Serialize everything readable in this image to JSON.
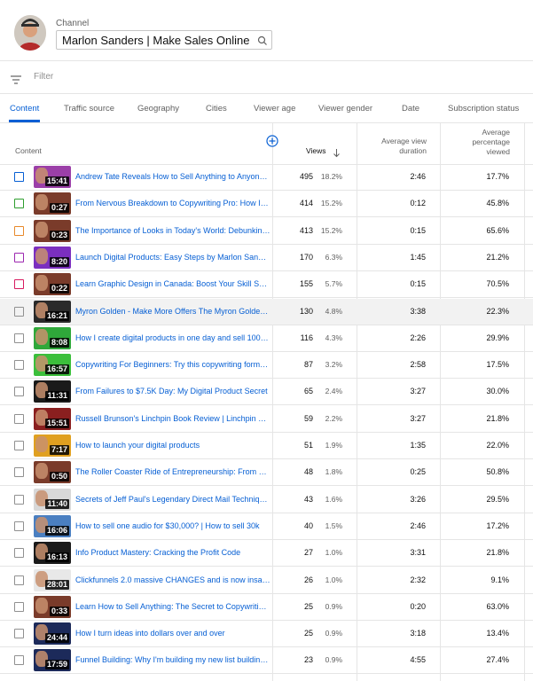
{
  "channel": {
    "label": "Channel",
    "name": "Marlon Sanders | Make Sales Online"
  },
  "filter": {
    "label": "Filter"
  },
  "tabs": [
    {
      "label": "Content",
      "active": true
    },
    {
      "label": "Traffic source"
    },
    {
      "label": "Geography"
    },
    {
      "label": "Cities"
    },
    {
      "label": "Viewer age"
    },
    {
      "label": "Viewer gender"
    },
    {
      "label": "Date"
    },
    {
      "label": "Subscription status"
    }
  ],
  "columns": {
    "content": "Content",
    "views": "Views",
    "avd": [
      "Average view",
      "duration"
    ],
    "avp": [
      "Average",
      "percentage",
      "viewed"
    ]
  },
  "colors": {
    "accent": "#065fd4"
  },
  "rows": [
    {
      "title": "Andrew Tate Reveals How to Sell Anything to Anyone | ...",
      "duration": "15:41",
      "views": "495",
      "pct": "18.2%",
      "avd": "2:46",
      "avp": "17.7%",
      "check": "#065fd4",
      "thumb": "#9b3fa8"
    },
    {
      "title": "From Nervous Breakdown to Copywriting Pro: How I O...",
      "duration": "0:27",
      "views": "414",
      "pct": "15.2%",
      "avd": "0:12",
      "avp": "45.8%",
      "check": "#2e9e2e",
      "thumb": "#7a3b2a"
    },
    {
      "title": "The Importance of Looks in Today's World: Debunking ...",
      "duration": "0:23",
      "views": "413",
      "pct": "15.2%",
      "avd": "0:15",
      "avp": "65.6%",
      "check": "#e8892b",
      "thumb": "#7a3b2a"
    },
    {
      "title": "Launch Digital Products: Easy Steps by Marlon Sanders",
      "duration": "8:20",
      "views": "170",
      "pct": "6.3%",
      "avd": "1:45",
      "avp": "21.2%",
      "check": "#9c27b0",
      "thumb": "#7b2fbf"
    },
    {
      "title": "Learn Graphic Design in Canada: Boost Your Skill Set a...",
      "duration": "0:22",
      "views": "155",
      "pct": "5.7%",
      "avd": "0:15",
      "avp": "70.5%",
      "check": "#d81b60",
      "thumb": "#7a3b2a"
    },
    {
      "title": "Myron Golden - Make More Offers The Myron Golden ...",
      "duration": "16:21",
      "views": "130",
      "pct": "4.8%",
      "avd": "3:38",
      "avp": "22.3%",
      "check": "#909090",
      "thumb": "#2a2a2a"
    },
    {
      "title": "How I create digital products in one day and sell 100 to...",
      "duration": "8:08",
      "views": "116",
      "pct": "4.3%",
      "avd": "2:26",
      "avp": "29.9%",
      "check": "#909090",
      "thumb": "#2fa83a"
    },
    {
      "title": "Copywriting For Beginners: Try this copywriting formula",
      "duration": "16:57",
      "views": "87",
      "pct": "3.2%",
      "avd": "2:58",
      "avp": "17.5%",
      "check": "#909090",
      "thumb": "#3bbf3b"
    },
    {
      "title": "From Failures to $7.5K Day: My Digital Product Secret",
      "duration": "11:31",
      "views": "65",
      "pct": "2.4%",
      "avd": "3:27",
      "avp": "30.0%",
      "check": "#909090",
      "thumb": "#1a1a1a"
    },
    {
      "title": "Russell Brunson's Linchpin Book Review | Linchpin boo...",
      "duration": "15:51",
      "views": "59",
      "pct": "2.2%",
      "avd": "3:27",
      "avp": "21.8%",
      "check": "#909090",
      "thumb": "#8a1f1f"
    },
    {
      "title": "How to launch your digital products",
      "duration": "7:17",
      "views": "51",
      "pct": "1.9%",
      "avd": "1:35",
      "avp": "22.0%",
      "check": "#909090",
      "thumb": "#e0a020"
    },
    {
      "title": "The Roller Coaster Ride of Entrepreneurship: From Sale...",
      "duration": "0:50",
      "views": "48",
      "pct": "1.8%",
      "avd": "0:25",
      "avp": "50.8%",
      "check": "#909090",
      "thumb": "#7a3b2a"
    },
    {
      "title": "Secrets of Jeff Paul's Legendary Direct Mail Techniques",
      "duration": "11:40",
      "views": "43",
      "pct": "1.6%",
      "avd": "3:26",
      "avp": "29.5%",
      "check": "#909090",
      "thumb": "#d8d8d8"
    },
    {
      "title": "How to sell one audio for $30,000? | How to sell 30k",
      "duration": "16:06",
      "views": "40",
      "pct": "1.5%",
      "avd": "2:46",
      "avp": "17.2%",
      "check": "#909090",
      "thumb": "#4a7fc1"
    },
    {
      "title": "Info Product Mastery: Cracking the Profit Code",
      "duration": "16:13",
      "views": "27",
      "pct": "1.0%",
      "avd": "3:31",
      "avp": "21.8%",
      "check": "#909090",
      "thumb": "#1a1a1a"
    },
    {
      "title": "Clickfunnels 2.0 massive CHANGES and is now insane",
      "duration": "28:01",
      "views": "26",
      "pct": "1.0%",
      "avd": "2:32",
      "avp": "9.1%",
      "check": "#909090",
      "thumb": "#e8e8e8"
    },
    {
      "title": "Learn How to Sell Anything: The Secret to Copywriting ...",
      "duration": "0:33",
      "views": "25",
      "pct": "0.9%",
      "avd": "0:20",
      "avp": "63.0%",
      "check": "#909090",
      "thumb": "#7a3b2a"
    },
    {
      "title": "How I turn ideas into dollars over and over",
      "duration": "24:44",
      "views": "25",
      "pct": "0.9%",
      "avd": "3:18",
      "avp": "13.4%",
      "check": "#909090",
      "thumb": "#1c2a5a"
    },
    {
      "title": "Funnel Building: Why I'm building my new list building f...",
      "duration": "17:59",
      "views": "23",
      "pct": "0.9%",
      "avd": "4:55",
      "avp": "27.4%",
      "check": "#909090",
      "thumb": "#1c2a5a"
    }
  ]
}
